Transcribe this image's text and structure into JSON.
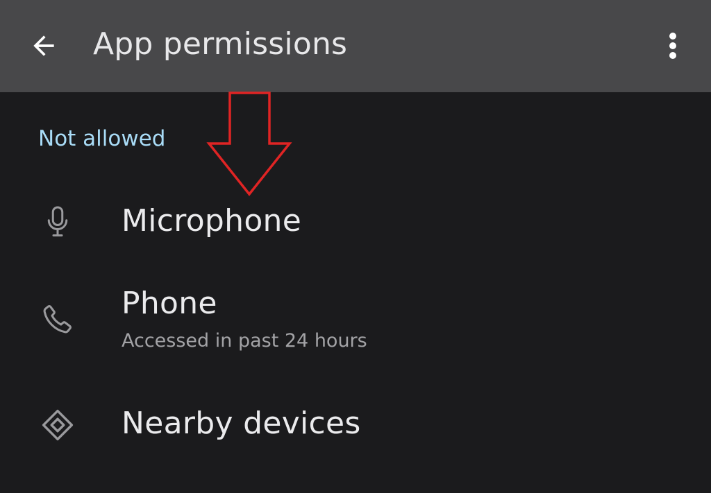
{
  "app_bar": {
    "title": "App permissions",
    "back_icon": "arrow-back-icon",
    "more_icon": "more-vert-icon",
    "background": "#48484a"
  },
  "section": {
    "header": "Not allowed",
    "header_color": "#a9dcf7"
  },
  "permissions": [
    {
      "label": "Microphone",
      "subtitle": "",
      "icon": "microphone-icon"
    },
    {
      "label": "Phone",
      "subtitle": "Accessed in past 24 hours",
      "icon": "phone-icon"
    },
    {
      "label": "Nearby devices",
      "subtitle": "",
      "icon": "nearby-devices-icon"
    }
  ],
  "annotation": {
    "type": "arrow-down-outline",
    "color": "#e02424"
  },
  "colors": {
    "background": "#1b1b1d",
    "text_primary": "#ebebed",
    "text_secondary": "#a3a3a6",
    "icon": "#9a9a9d"
  }
}
